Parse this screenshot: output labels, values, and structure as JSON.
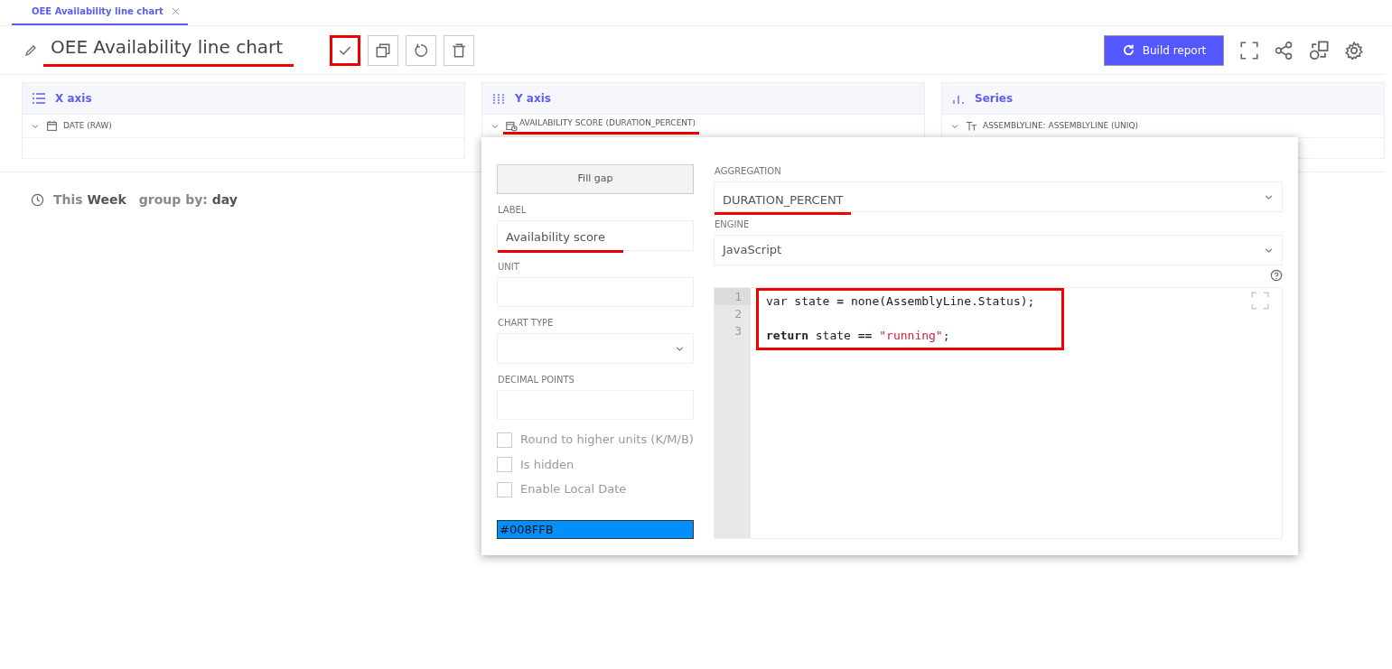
{
  "tabs": [
    {
      "label": "OEE Availability line chart",
      "selected": true
    }
  ],
  "header": {
    "title": "OEE Availability line chart",
    "title_annotated": true,
    "build_button": "Build report"
  },
  "toolbar": [
    {
      "kind": "check",
      "annotated": true
    },
    {
      "kind": "copy",
      "annotated": false
    },
    {
      "kind": "reset",
      "annotated": false
    },
    {
      "kind": "delete",
      "annotated": false
    }
  ],
  "panels": [
    {
      "kind": "x",
      "title": "X axis",
      "field": {
        "label": "DATE (RAW)",
        "annotated": false
      }
    },
    {
      "kind": "y",
      "title": "Y axis",
      "field": {
        "label": "AVAILABILITY SCORE (DURATION_PERCENT)",
        "annotated": true
      }
    },
    {
      "kind": "series",
      "title": "Series",
      "field": {
        "label": "ASSEMBLYLINE: ASSEMBLYLINE (UNIQ)",
        "annotated": false
      }
    }
  ],
  "period": {
    "range_prefix": "This",
    "range": "Week",
    "group_label": "group by:",
    "group": "day"
  },
  "editor": {
    "fill_gap": "Fill gap",
    "label": {
      "caption": "LABEL",
      "value": "Availability score",
      "annotated": true
    },
    "unit": {
      "caption": "UNIT"
    },
    "chart_type": {
      "caption": "CHART TYPE"
    },
    "decimal_points": {
      "caption": "DECIMAL POINTS"
    },
    "checkboxes": [
      {
        "label": "Round to higher units (K/M/B)",
        "checked": false
      },
      {
        "label": "Is hidden",
        "checked": false
      },
      {
        "label": "Enable Local Date",
        "checked": false
      }
    ],
    "color": {
      "value": "#008FFB",
      "color": "#008ffb"
    },
    "aggregation": {
      "caption": "AGGREGATION",
      "value": "DURATION_PERCENT",
      "annotated": true
    },
    "engine": {
      "caption": "ENGINE",
      "value": "JavaScript"
    },
    "code_annotated": true,
    "code": [
      {
        "number": "1",
        "tokens": [
          {
            "kind": "plain",
            "text": "var state "
          },
          {
            "kind": "operator",
            "text": "="
          },
          {
            "kind": "plain",
            "text": " none(AssemblyLine.Status);"
          }
        ]
      },
      {
        "number": "2"
      },
      {
        "number": "3",
        "tokens": [
          {
            "kind": "keyword",
            "text": "return"
          },
          {
            "kind": "plain",
            "text": " state "
          },
          {
            "kind": "operator",
            "text": "=="
          },
          {
            "kind": "string",
            "text": " \"running\""
          },
          {
            "kind": "plain",
            "text": ";"
          }
        ]
      }
    ]
  }
}
